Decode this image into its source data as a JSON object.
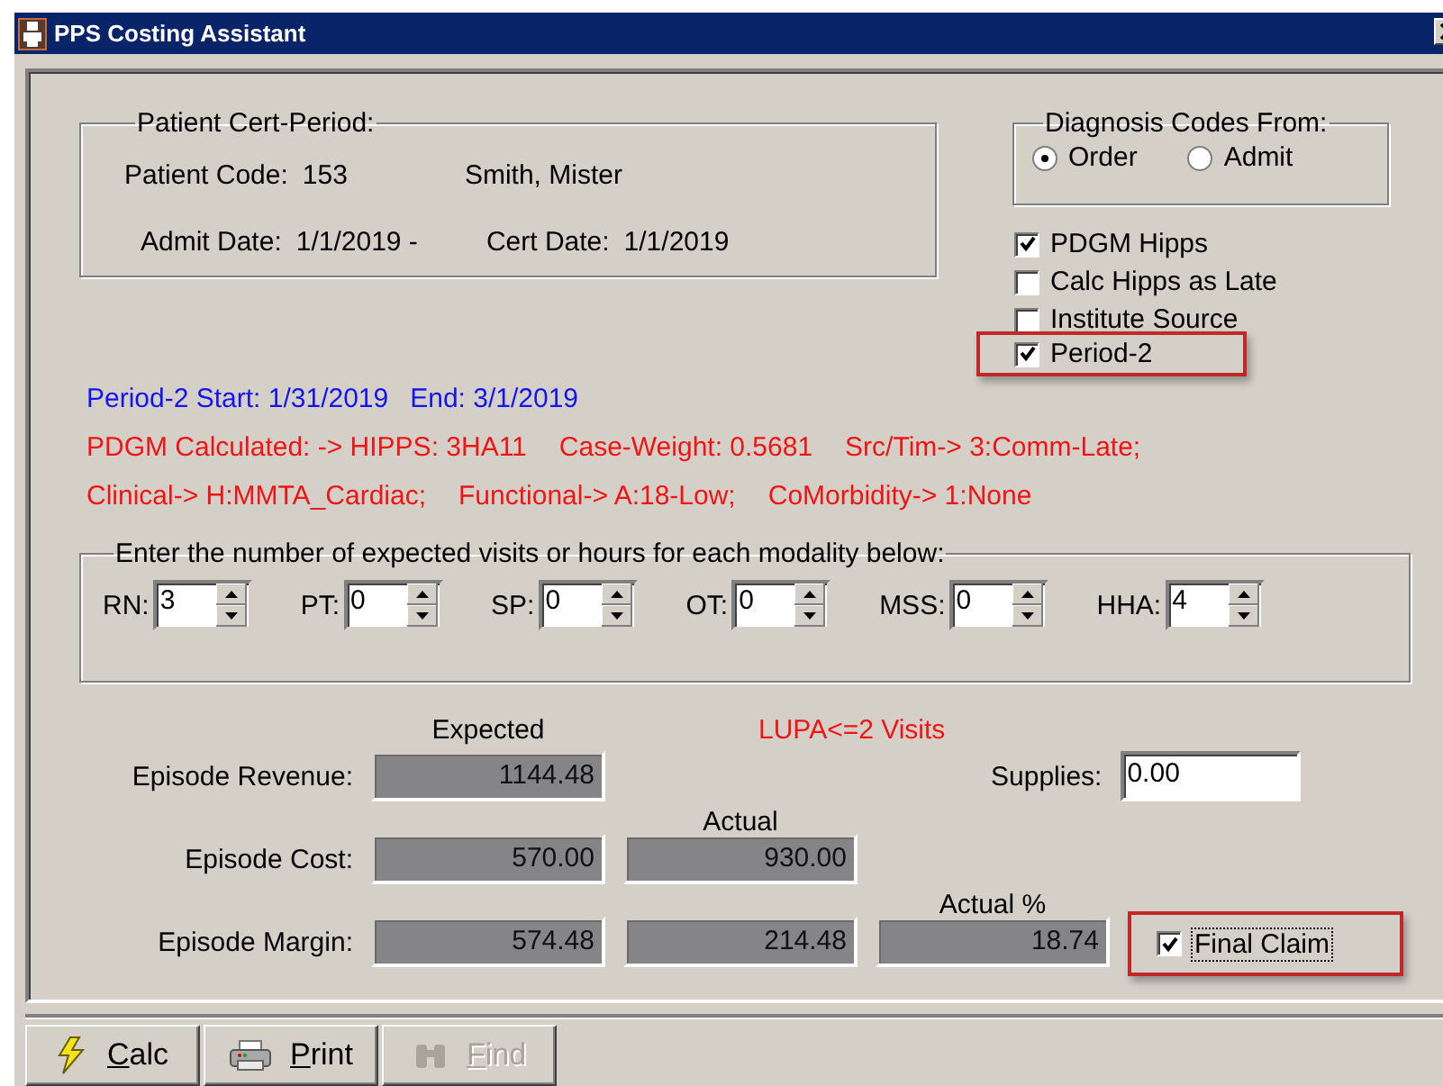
{
  "window": {
    "title": "PPS Costing Assistant"
  },
  "cert_period": {
    "legend": "Patient Cert-Period:",
    "patient_code_label": "Patient Code:",
    "patient_code": "153",
    "patient_name": "Smith, Mister",
    "admit_date_label": "Admit Date:",
    "admit_date": "1/1/2019 -",
    "cert_date_label": "Cert Date:",
    "cert_date": "1/1/2019"
  },
  "diagnosis_codes": {
    "legend": "Diagnosis Codes From:",
    "options": [
      {
        "label": "Order",
        "selected": true
      },
      {
        "label": "Admit",
        "selected": false
      }
    ]
  },
  "options": [
    {
      "label": "PDGM Hipps",
      "checked": true,
      "highlighted": false
    },
    {
      "label": "Calc Hipps as Late",
      "checked": false,
      "highlighted": false
    },
    {
      "label": "Institute Source",
      "checked": false,
      "highlighted": false
    },
    {
      "label": "Period-2",
      "checked": true,
      "highlighted": true
    }
  ],
  "info_lines": [
    {
      "kind": "period",
      "parts": [
        "Period-2 Start: 1/31/2019",
        "End: 3/1/2019"
      ]
    },
    {
      "kind": "calc",
      "parts": [
        "PDGM Calculated: -> HIPPS: 3HA11",
        "Case-Weight: 0.5681",
        "Src/Tim-> 3:Comm-Late;"
      ]
    },
    {
      "kind": "calc",
      "parts": [
        "Clinical-> H:MMTA_Cardiac;",
        "Functional-> A:18-Low;",
        "CoMorbidity-> 1:None"
      ]
    }
  ],
  "modalities": {
    "legend": "Enter the number of expected visits or hours for each modality below:",
    "items": [
      {
        "label": "RN:",
        "value": "3"
      },
      {
        "label": "PT:",
        "value": "0"
      },
      {
        "label": "SP:",
        "value": "0"
      },
      {
        "label": "OT:",
        "value": "0"
      },
      {
        "label": "MSS:",
        "value": "0"
      },
      {
        "label": "HHA:",
        "value": "4"
      }
    ]
  },
  "results": {
    "expected_header": "Expected",
    "lupa_note": "LUPA<=2 Visits",
    "actual_header": "Actual",
    "actual_pct_header": "Actual %",
    "supplies_label": "Supplies:",
    "supplies": "0.00",
    "revenue": {
      "label": "Episode Revenue:",
      "expected": "1144.48"
    },
    "cost": {
      "label": "Episode Cost:",
      "expected": "570.00",
      "actual": "930.00"
    },
    "margin": {
      "label": "Episode Margin:",
      "expected": "574.48",
      "actual": "214.48",
      "actual_pct": "18.74"
    },
    "final_claim": {
      "label": "Final Claim",
      "checked": true,
      "highlighted": true
    }
  },
  "toolbar": [
    {
      "label": "Calc",
      "kind": "lightning",
      "disabled": false
    },
    {
      "label": "Print",
      "kind": "printer",
      "disabled": false
    },
    {
      "label": "Find",
      "kind": "binoculars",
      "disabled": true
    }
  ]
}
